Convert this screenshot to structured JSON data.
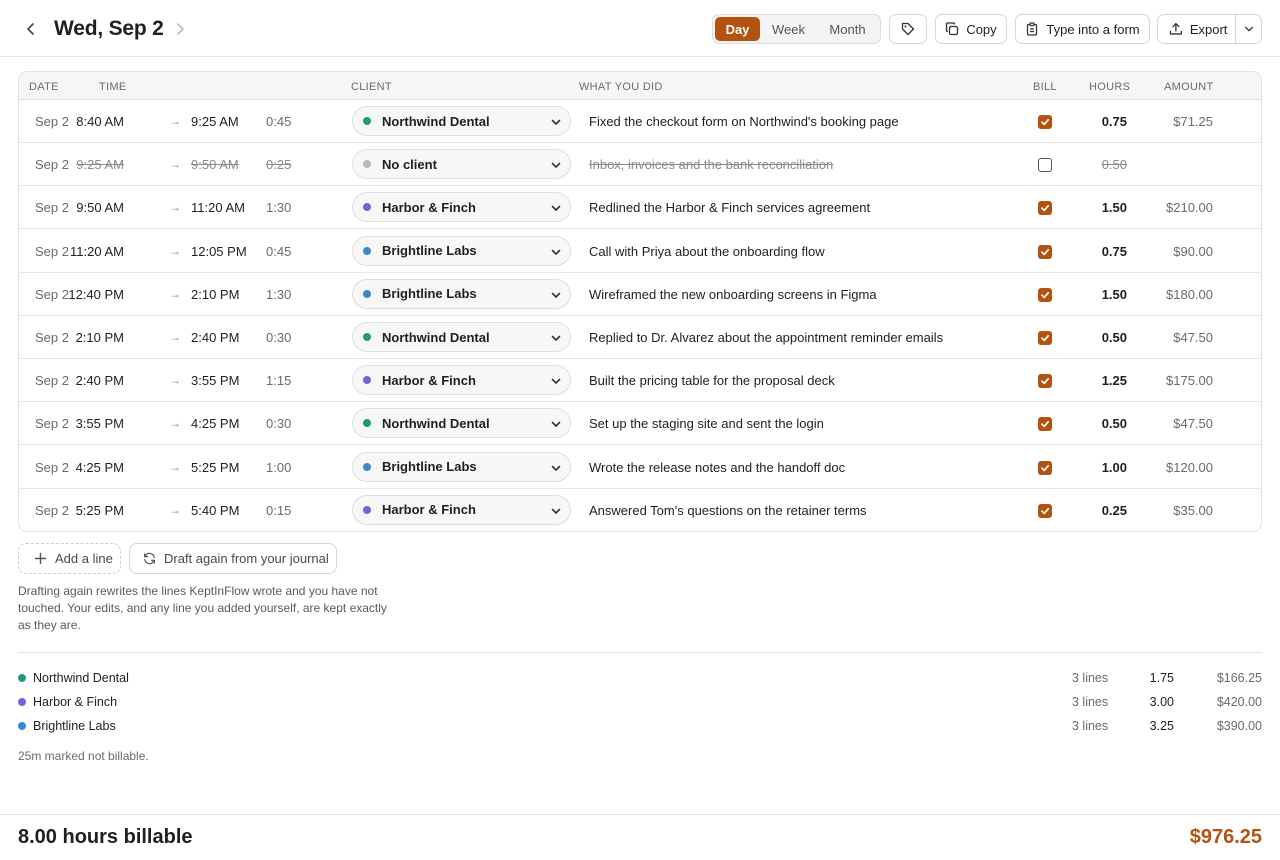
{
  "header": {
    "title": "Wed, Sep 2",
    "views": [
      "Day",
      "Week",
      "Month"
    ],
    "active_view": "Day",
    "copy_label": "Copy",
    "form_label": "Type into a form",
    "export_label": "Export"
  },
  "colors": {
    "accent": "#b4530f",
    "northwind": "#1e9b7f",
    "harbor": "#7b5fd6",
    "brightline": "#3a86d1",
    "noclient": "#b8b8b8"
  },
  "table": {
    "headers": {
      "date": "DATE",
      "time": "TIME",
      "client": "CLIENT",
      "what": "WHAT YOU DID",
      "bill": "BILL",
      "hours": "HOURS",
      "amount": "AMOUNT"
    },
    "rows": [
      {
        "date": "Sep 2",
        "start": "8:40 AM",
        "arrow": "→",
        "end": "9:25 AM",
        "dur": "0:45",
        "client": "Northwind Dental",
        "color": "#1e9b7f",
        "desc": "Fixed the checkout form on Northwind's booking page",
        "bill": true,
        "hours": "0.75",
        "amount": "$71.25",
        "struck": false
      },
      {
        "date": "Sep 2",
        "start": "9:25 AM",
        "arrow": "→",
        "end": "9:50 AM",
        "dur": "0:25",
        "client": "No client",
        "color": "#b8b8b8",
        "desc": "Inbox, invoices and the bank reconciliation",
        "bill": false,
        "hours": "0.50",
        "amount": "",
        "struck": true
      },
      {
        "date": "Sep 2",
        "start": "9:50 AM",
        "arrow": "→",
        "end": "11:20 AM",
        "dur": "1:30",
        "client": "Harbor & Finch",
        "color": "#7b5fd6",
        "desc": "Redlined the Harbor & Finch services agreement",
        "bill": true,
        "hours": "1.50",
        "amount": "$210.00",
        "struck": false
      },
      {
        "date": "Sep 2",
        "start": "11:20 AM",
        "arrow": "→",
        "end": "12:05 PM",
        "dur": "0:45",
        "client": "Brightline Labs",
        "color": "#3a86d1",
        "desc": "Call with Priya about the onboarding flow",
        "bill": true,
        "hours": "0.75",
        "amount": "$90.00",
        "struck": false
      },
      {
        "date": "Sep 2",
        "start": "12:40 PM",
        "arrow": "→",
        "end": "2:10 PM",
        "dur": "1:30",
        "client": "Brightline Labs",
        "color": "#3a86d1",
        "desc": "Wireframed the new onboarding screens in Figma",
        "bill": true,
        "hours": "1.50",
        "amount": "$180.00",
        "struck": false
      },
      {
        "date": "Sep 2",
        "start": "2:10 PM",
        "arrow": "→",
        "end": "2:40 PM",
        "dur": "0:30",
        "client": "Northwind Dental",
        "color": "#1e9b7f",
        "desc": "Replied to Dr. Alvarez about the appointment reminder emails",
        "bill": true,
        "hours": "0.50",
        "amount": "$47.50",
        "struck": false
      },
      {
        "date": "Sep 2",
        "start": "2:40 PM",
        "arrow": "→",
        "end": "3:55 PM",
        "dur": "1:15",
        "client": "Harbor & Finch",
        "color": "#7b5fd6",
        "desc": "Built the pricing table for the proposal deck",
        "bill": true,
        "hours": "1.25",
        "amount": "$175.00",
        "struck": false
      },
      {
        "date": "Sep 2",
        "start": "3:55 PM",
        "arrow": "→",
        "end": "4:25 PM",
        "dur": "0:30",
        "client": "Northwind Dental",
        "color": "#1e9b7f",
        "desc": "Set up the staging site and sent the login",
        "bill": true,
        "hours": "0.50",
        "amount": "$47.50",
        "struck": false
      },
      {
        "date": "Sep 2",
        "start": "4:25 PM",
        "arrow": "→",
        "end": "5:25 PM",
        "dur": "1:00",
        "client": "Brightline Labs",
        "color": "#3a86d1",
        "desc": "Wrote the release notes and the handoff doc",
        "bill": true,
        "hours": "1.00",
        "amount": "$120.00",
        "struck": false
      },
      {
        "date": "Sep 2",
        "start": "5:25 PM",
        "arrow": "→",
        "end": "5:40 PM",
        "dur": "0:15",
        "client": "Harbor & Finch",
        "color": "#7b5fd6",
        "desc": "Answered Tom's questions on the retainer terms",
        "bill": true,
        "hours": "0.25",
        "amount": "$35.00",
        "struck": false
      }
    ]
  },
  "actions": {
    "add_line": "Add a line",
    "draft_again": "Draft again from your journal"
  },
  "note": "Drafting again rewrites the lines KeptInFlow wrote and you have not touched. Your edits, and any line you added yourself, are kept exactly as they are.",
  "summary": [
    {
      "name": "Northwind Dental",
      "color": "#1e9b7f",
      "lines": "3 lines",
      "hours": "1.75",
      "amount": "$166.25"
    },
    {
      "name": "Harbor & Finch",
      "color": "#7b5fd6",
      "lines": "3 lines",
      "hours": "3.00",
      "amount": "$420.00"
    },
    {
      "name": "Brightline Labs",
      "color": "#3a86d1",
      "lines": "3 lines",
      "hours": "3.25",
      "amount": "$390.00"
    }
  ],
  "not_billable": "25m marked not billable.",
  "footer": {
    "total_label": "8.00 hours billable",
    "total_amount": "$976.25"
  }
}
